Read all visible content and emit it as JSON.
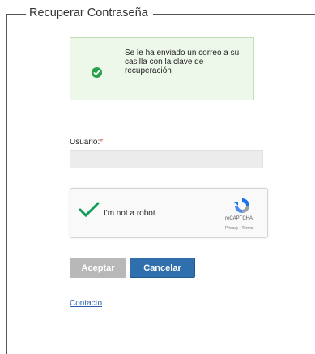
{
  "form": {
    "title": "Recuperar Contraseña"
  },
  "alert": {
    "message": "Se le ha enviado un correo a su casilla con la clave de recuperación",
    "icon": "check-circle-icon",
    "color": "#27a24a"
  },
  "user_field": {
    "label": "Usuario:",
    "required_mark": "*",
    "value": "",
    "placeholder": ""
  },
  "captcha": {
    "label": "I'm not a robot",
    "brand": "reCAPTCHA",
    "links": "Privacy - Terms",
    "checked": true
  },
  "buttons": {
    "accept": "Aceptar",
    "cancel": "Cancelar"
  },
  "footer": {
    "contact_link": "Contacto"
  }
}
